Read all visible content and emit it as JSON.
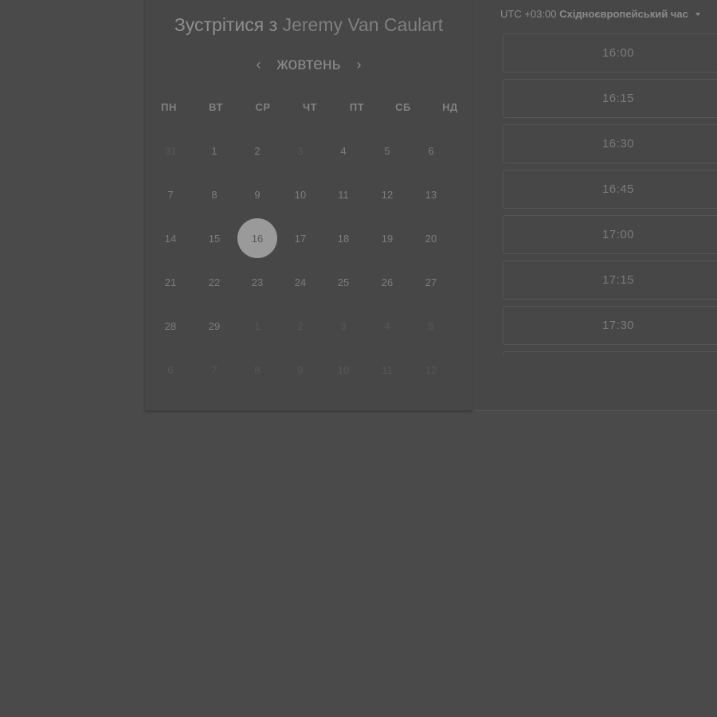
{
  "header": {
    "title_prefix": "Зустрітися з",
    "host_name": "Jeremy Van Caulart"
  },
  "calendar": {
    "month_label": "жовтень",
    "prev_icon": "‹",
    "next_icon": "›",
    "weekdays": [
      "ПН",
      "ВТ",
      "СР",
      "ЧТ",
      "ПТ",
      "СБ",
      "НД"
    ],
    "weeks": [
      [
        {
          "d": "31",
          "muted": true
        },
        {
          "d": "1"
        },
        {
          "d": "2"
        },
        {
          "d": "3",
          "muted": true
        },
        {
          "d": "4"
        },
        {
          "d": "5"
        },
        {
          "d": "6"
        }
      ],
      [
        {
          "d": "7"
        },
        {
          "d": "8"
        },
        {
          "d": "9"
        },
        {
          "d": "10"
        },
        {
          "d": "11"
        },
        {
          "d": "12"
        },
        {
          "d": "13"
        }
      ],
      [
        {
          "d": "14"
        },
        {
          "d": "15"
        },
        {
          "d": "16",
          "selected": true
        },
        {
          "d": "17"
        },
        {
          "d": "18"
        },
        {
          "d": "19"
        },
        {
          "d": "20"
        }
      ],
      [
        {
          "d": "21"
        },
        {
          "d": "22"
        },
        {
          "d": "23"
        },
        {
          "d": "24"
        },
        {
          "d": "25"
        },
        {
          "d": "26"
        },
        {
          "d": "27"
        }
      ],
      [
        {
          "d": "28"
        },
        {
          "d": "29"
        },
        {
          "d": "1",
          "muted": true
        },
        {
          "d": "2",
          "muted": true
        },
        {
          "d": "3",
          "muted": true
        },
        {
          "d": "4",
          "muted": true
        },
        {
          "d": "5",
          "muted": true
        }
      ],
      [
        {
          "d": "6",
          "muted": true
        },
        {
          "d": "7",
          "muted": true
        },
        {
          "d": "8",
          "muted": true
        },
        {
          "d": "9",
          "muted": true
        },
        {
          "d": "10",
          "muted": true
        },
        {
          "d": "11",
          "muted": true
        },
        {
          "d": "12",
          "muted": true
        }
      ]
    ]
  },
  "timezone": {
    "offset": "UTC +03:00",
    "name": "Східноєвропейський час"
  },
  "time_slots": [
    "16:00",
    "16:15",
    "16:30",
    "16:45",
    "17:00",
    "17:15",
    "17:30"
  ],
  "colors": {
    "overlay_background": "#4a4a4a",
    "selected_day": "#9a9a9a"
  }
}
